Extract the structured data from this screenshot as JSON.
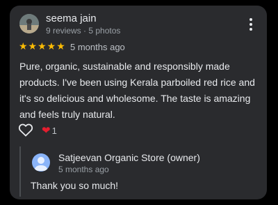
{
  "review": {
    "author": "seema jain",
    "author_meta": "9 reviews · 5 photos",
    "rating": 5,
    "stars": "★★★★★",
    "time": "5 months ago",
    "text": "Pure, organic, sustainable and responsibly made products. I've been using Kerala parboiled red rice and it's so delicious and wholesome. The taste is amazing and feels truly natural.",
    "like_count": "1"
  },
  "owner_reply": {
    "name": "Satjeevan Organic Store (owner)",
    "time": "5 months ago",
    "text": "Thank you so much!"
  },
  "icons": {
    "menu": "more-vert-icon",
    "like": "heart-outline-icon",
    "reaction": "red-heart-icon"
  },
  "colors": {
    "card_bg": "#2a2b2e",
    "star": "#fbbc04",
    "heart": "#e41e2f",
    "owner_avatar": "#8ab4f8"
  }
}
